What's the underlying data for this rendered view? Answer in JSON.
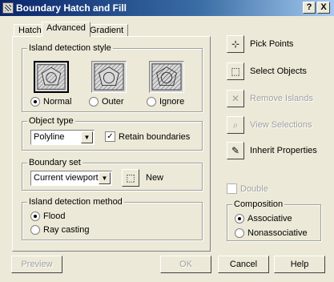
{
  "window": {
    "title": "Boundary Hatch and Fill",
    "help_label": "?",
    "close_label": "X"
  },
  "tabs": [
    {
      "label": "Hatch"
    },
    {
      "label": "Advanced"
    },
    {
      "label": "Gradient"
    }
  ],
  "island_detection_style": {
    "label": "Island detection style",
    "options": [
      {
        "label": "Normal",
        "selected": true
      },
      {
        "label": "Outer",
        "selected": false
      },
      {
        "label": "Ignore",
        "selected": false
      }
    ]
  },
  "object_type": {
    "label": "Object type",
    "value": "Polyline",
    "retain_boundaries_label": "Retain boundaries",
    "retain_boundaries_checked": true
  },
  "boundary_set": {
    "label": "Boundary set",
    "value": "Current viewport",
    "new_label": "New"
  },
  "island_detection_method": {
    "label": "Island detection method",
    "options": [
      {
        "label": "Flood",
        "selected": true
      },
      {
        "label": "Ray casting",
        "selected": false
      }
    ]
  },
  "side_actions": [
    {
      "label": "Pick Points",
      "icon": "pick-points-icon",
      "enabled": true
    },
    {
      "label": "Select Objects",
      "icon": "select-objects-icon",
      "enabled": true
    },
    {
      "label": "Remove Islands",
      "icon": "remove-islands-icon",
      "enabled": false
    },
    {
      "label": "View Selections",
      "icon": "view-selections-icon",
      "enabled": false
    },
    {
      "label": "Inherit Properties",
      "icon": "inherit-properties-icon",
      "enabled": true
    }
  ],
  "double": {
    "label": "Double",
    "checked": false
  },
  "composition": {
    "label": "Composition",
    "options": [
      {
        "label": "Associative",
        "selected": true
      },
      {
        "label": "Nonassociative",
        "selected": false
      }
    ]
  },
  "footer": {
    "preview_label": "Preview",
    "ok_label": "OK",
    "cancel_label": "Cancel",
    "help_label": "Help"
  }
}
